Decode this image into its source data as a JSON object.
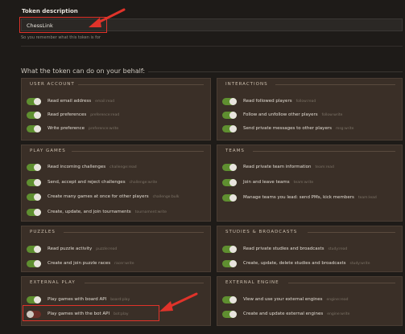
{
  "token": {
    "label": "Token description",
    "value": "ChessLink",
    "hint": "So you remember what this token is for"
  },
  "permissions_title": "What the token can do on your behalf:",
  "colors": {
    "toggle_on": "#5f8f30",
    "toggle_off": "#6a2e27",
    "annotation": "#e0332a"
  },
  "cards": [
    {
      "id": "user-account",
      "title": "USER ACCOUNT",
      "items": [
        {
          "label": "Read email address",
          "scope": "email:read",
          "on": true
        },
        {
          "label": "Read preferences",
          "scope": "preference:read",
          "on": true
        },
        {
          "label": "Write preference",
          "scope": "preference:write",
          "on": true
        }
      ]
    },
    {
      "id": "interactions",
      "title": "INTERACTIONS",
      "items": [
        {
          "label": "Read followed players",
          "scope": "follow:read",
          "on": true
        },
        {
          "label": "Follow and unfollow other players",
          "scope": "follow:write",
          "on": true
        },
        {
          "label": "Send private messages to other players",
          "scope": "msg:write",
          "on": true
        }
      ]
    },
    {
      "id": "play-games",
      "title": "PLAY GAMES",
      "items": [
        {
          "label": "Read incoming challenges",
          "scope": "challenge:read",
          "on": true
        },
        {
          "label": "Send, accept and reject challenges",
          "scope": "challenge:write",
          "on": true
        },
        {
          "label": "Create many games at once for other players",
          "scope": "challenge:bulk",
          "on": true
        },
        {
          "label": "Create, update, and join tournaments",
          "scope": "tournament:write",
          "on": true
        }
      ]
    },
    {
      "id": "teams",
      "title": "TEAMS",
      "items": [
        {
          "label": "Read private team information",
          "scope": "team:read",
          "on": true
        },
        {
          "label": "Join and leave teams",
          "scope": "team:write",
          "on": true
        },
        {
          "label": "Manage teams you lead: send PMs, kick members",
          "scope": "team:lead",
          "on": true
        }
      ]
    },
    {
      "id": "puzzles",
      "title": "PUZZLES",
      "items": [
        {
          "label": "Read puzzle activity",
          "scope": "puzzle:read",
          "on": true
        },
        {
          "label": "Create and join puzzle races",
          "scope": "racer:write",
          "on": true
        }
      ]
    },
    {
      "id": "studies",
      "title": "STUDIES & BROADCASTS",
      "items": [
        {
          "label": "Read private studies and broadcasts",
          "scope": "study:read",
          "on": true
        },
        {
          "label": "Create, update, delete studies and broadcasts",
          "scope": "study:write",
          "on": true
        }
      ]
    },
    {
      "id": "external-play",
      "title": "EXTERNAL PLAY",
      "items": [
        {
          "label": "Play games with board API",
          "scope": "board:play",
          "on": true
        },
        {
          "label": "Play games with the bot API",
          "scope": "bot:play",
          "on": false
        }
      ]
    },
    {
      "id": "external-engine",
      "title": "EXTERNAL ENGINE",
      "items": [
        {
          "label": "View and use your external engines",
          "scope": "engine:read",
          "on": true
        },
        {
          "label": "Create and update external engines",
          "scope": "engine:write",
          "on": true
        }
      ]
    }
  ]
}
